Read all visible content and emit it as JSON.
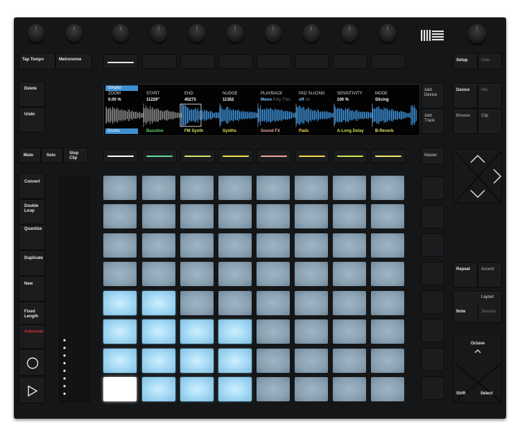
{
  "top_left": {
    "tap_tempo": "Tap Tempo",
    "metronome": "Metronome"
  },
  "top_right": {
    "setup": "Setup",
    "user": "User"
  },
  "left_column": {
    "delete": "Delete",
    "undo": "Undo",
    "mute": "Mute",
    "solo": "Solo",
    "stop_clip": "Stop\nClip",
    "convert": "Convert",
    "double_loop": "Double\nLoop",
    "quantize": "Quantize",
    "duplicate": "Duplicate",
    "new": "New",
    "fixed_length": "Fixed\nLength",
    "automate": "Automate"
  },
  "right_column": {
    "add_device": "Add\nDevice",
    "add_track": "Add\nTrack",
    "master": "Master",
    "device": "Device",
    "mix": "Mix",
    "browse": "Browse",
    "clip": "Clip",
    "repeat": "Repeat",
    "accent": "Accent",
    "layout": "Layout",
    "note": "Note",
    "session": "Session",
    "octave": "Octave",
    "shift": "Shift",
    "select": "Select"
  },
  "screen": {
    "top_tab": "Simpler",
    "bottom_tab": "Drums",
    "params": [
      {
        "name": "ZOOM",
        "value": "0.00 %",
        "extra": ""
      },
      {
        "name": "START",
        "value": "11229\"",
        "extra": ""
      },
      {
        "name": "END",
        "value": "45273",
        "extra": ""
      },
      {
        "name": "NUDGE",
        "value": "11352",
        "extra": ""
      },
      {
        "name": "PLAYBACK",
        "value": "Mono",
        "extra": "Poly Thru"
      },
      {
        "name": "PAD SLICING",
        "value": "off",
        "extra": "on"
      },
      {
        "name": "SENSITIVITY",
        "value": "100 %",
        "extra": ""
      },
      {
        "name": "MODE",
        "value": "Slicing",
        "extra": ""
      }
    ],
    "tracks": [
      {
        "name": "Bassline",
        "color": "#5dd16a"
      },
      {
        "name": "FM Synth",
        "color": "#d6e86a"
      },
      {
        "name": "Synths",
        "color": "#f0e34c"
      },
      {
        "name": "Sound FX",
        "color": "#f2a7a0"
      },
      {
        "name": "Pads",
        "color": "#f6d84a"
      },
      {
        "name": "A-Long Delay",
        "color": "#cfe24a"
      },
      {
        "name": "B-Reverb",
        "color": "#e8e46a"
      }
    ]
  },
  "track_select_colors": [
    "#ffffff",
    "#5fe0a0",
    "#d6e86a",
    "#f0e34c",
    "#f4a59a",
    "#f6d84a",
    "#d4e74e",
    "#f4e86a"
  ],
  "pad_grid": [
    [
      "dark",
      "dark",
      "dark",
      "dark",
      "dark",
      "dark",
      "dark",
      "dark"
    ],
    [
      "dark",
      "dark",
      "dark",
      "dark",
      "dark",
      "dark",
      "dark",
      "dark"
    ],
    [
      "dark",
      "dark",
      "dark",
      "dark",
      "dark",
      "dark",
      "dark",
      "dark"
    ],
    [
      "dark",
      "dark",
      "dark",
      "dark",
      "dark",
      "dark",
      "dark",
      "dark"
    ],
    [
      "lit",
      "lit",
      "dark",
      "dark",
      "dark",
      "dark",
      "dark",
      "dark"
    ],
    [
      "lit",
      "lit",
      "lit",
      "lit",
      "dark",
      "dark",
      "dark",
      "dark"
    ],
    [
      "lit",
      "lit",
      "lit",
      "lit",
      "dark",
      "dark",
      "dark",
      "dark"
    ],
    [
      "white",
      "lit",
      "lit",
      "lit",
      "dark",
      "dark",
      "dark",
      "dark"
    ]
  ],
  "icons": {
    "logo": "ableton-logo-icon",
    "record": "record-icon",
    "play": "play-icon",
    "touch_strip": "touch-strip-icon",
    "nav": "dpad-arrows-icon",
    "octave": "octave-arrow-icon"
  }
}
